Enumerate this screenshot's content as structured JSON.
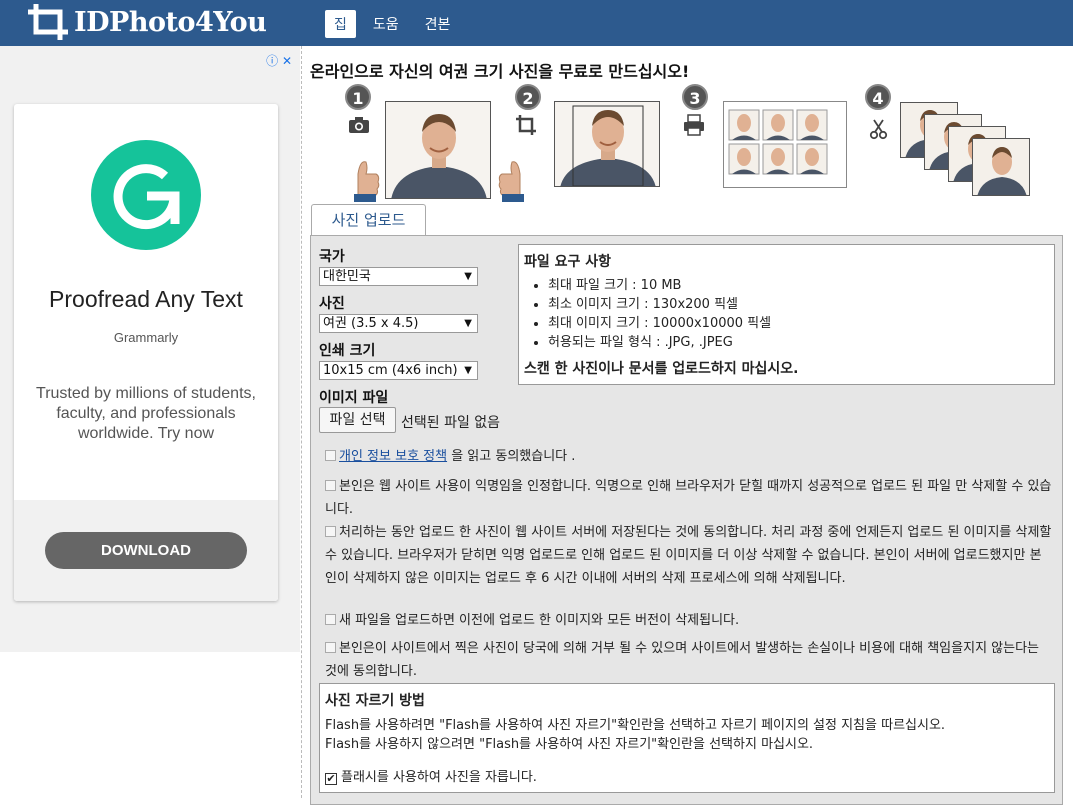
{
  "header": {
    "brand": "IDPhoto4You",
    "nav": [
      {
        "label": "집",
        "active": true
      },
      {
        "label": "도움",
        "active": false
      },
      {
        "label": "견본",
        "active": false
      }
    ]
  },
  "ad": {
    "info_close": "ⓘ ✕",
    "headline": "Proofread Any Text",
    "brand": "Grammarly",
    "description": "Trusted by millions of students, faculty, and professionals worldwide. Try now",
    "button": "DOWNLOAD",
    "brand_color": "#15c39a"
  },
  "main": {
    "headline": "온라인으로 자신의 여권 크기 사진을 무료로 만드십시오!",
    "steps": [
      "1",
      "2",
      "3",
      "4"
    ],
    "tab": "사진 업로드",
    "form": {
      "country_label": "국가",
      "country_value": "대한민국",
      "photo_label": "사진",
      "photo_value": "여권 (3.5 x 4.5)",
      "print_label": "인쇄 크기",
      "print_value": "10x15 cm (4x6 inch)",
      "image_label": "이미지 파일",
      "file_button": "파일 선택",
      "file_status": "선택된 파일 없음"
    },
    "requirements": {
      "title": "파일 요구 사항",
      "items": [
        "최대 파일 크기 : 10 MB",
        "최소 이미지 크기 : 130x200 픽셀",
        "최대 이미지 크기 : 10000x10000 픽셀",
        "허용되는 파일 형식 : .JPG, .JPEG"
      ],
      "warning": "스캔 한 사진이나 문서를 업로드하지 마십시오."
    },
    "consents": {
      "privacy_link": "개인 정보 보호 정책",
      "privacy_suffix": " 을 읽고 동의했습니다 .",
      "anonymous": "본인은 웹 사이트 사용이 익명임을 인정합니다. 익명으로 인해 브라우저가 닫힐 때까지 성공적으로 업로드 된 파일 만 삭제할 수 있습니다.",
      "storage": "처리하는 동안 업로드 한 사진이 웹 사이트 서버에 저장된다는 것에 동의합니다. 처리 과정 중에 언제든지 업로드 된 이미지를 삭제할 수 있습니다. 브라우저가 닫히면 익명 업로드로 인해 업로드 된 이미지를 더 이상 삭제할 수 없습니다. 본인이 서버에 업로드했지만 본인이 삭제하지 않은 이미지는 업로드 후 6 시간 이내에 서버의 삭제 프로세스에 의해 삭제됩니다.",
      "replace": "새 파일을 업로드하면 이전에 업로드 한 이미지와 모든 버전이 삭제됩니다.",
      "rejection": "본인은이 사이트에서 찍은 사진이 당국에 의해 거부 될 수 있으며 사이트에서 발생하는 손실이나 비용에 대해 책임을지지 않는다는 것에 동의합니다."
    },
    "crop": {
      "title": "사진 자르기 방법",
      "line1": "Flash를 사용하려면 \"Flash를 사용하여 사진 자르기\"확인란을 선택하고 자르기 페이지의 설정 지침을 따르십시오.",
      "line2": "Flash를 사용하지 않으려면 \"Flash를 사용하여 사진 자르기\"확인란을 선택하지 마십시오.",
      "checkbox_label": "플래시를 사용하여 사진을 자릅니다.",
      "checked": true
    }
  }
}
